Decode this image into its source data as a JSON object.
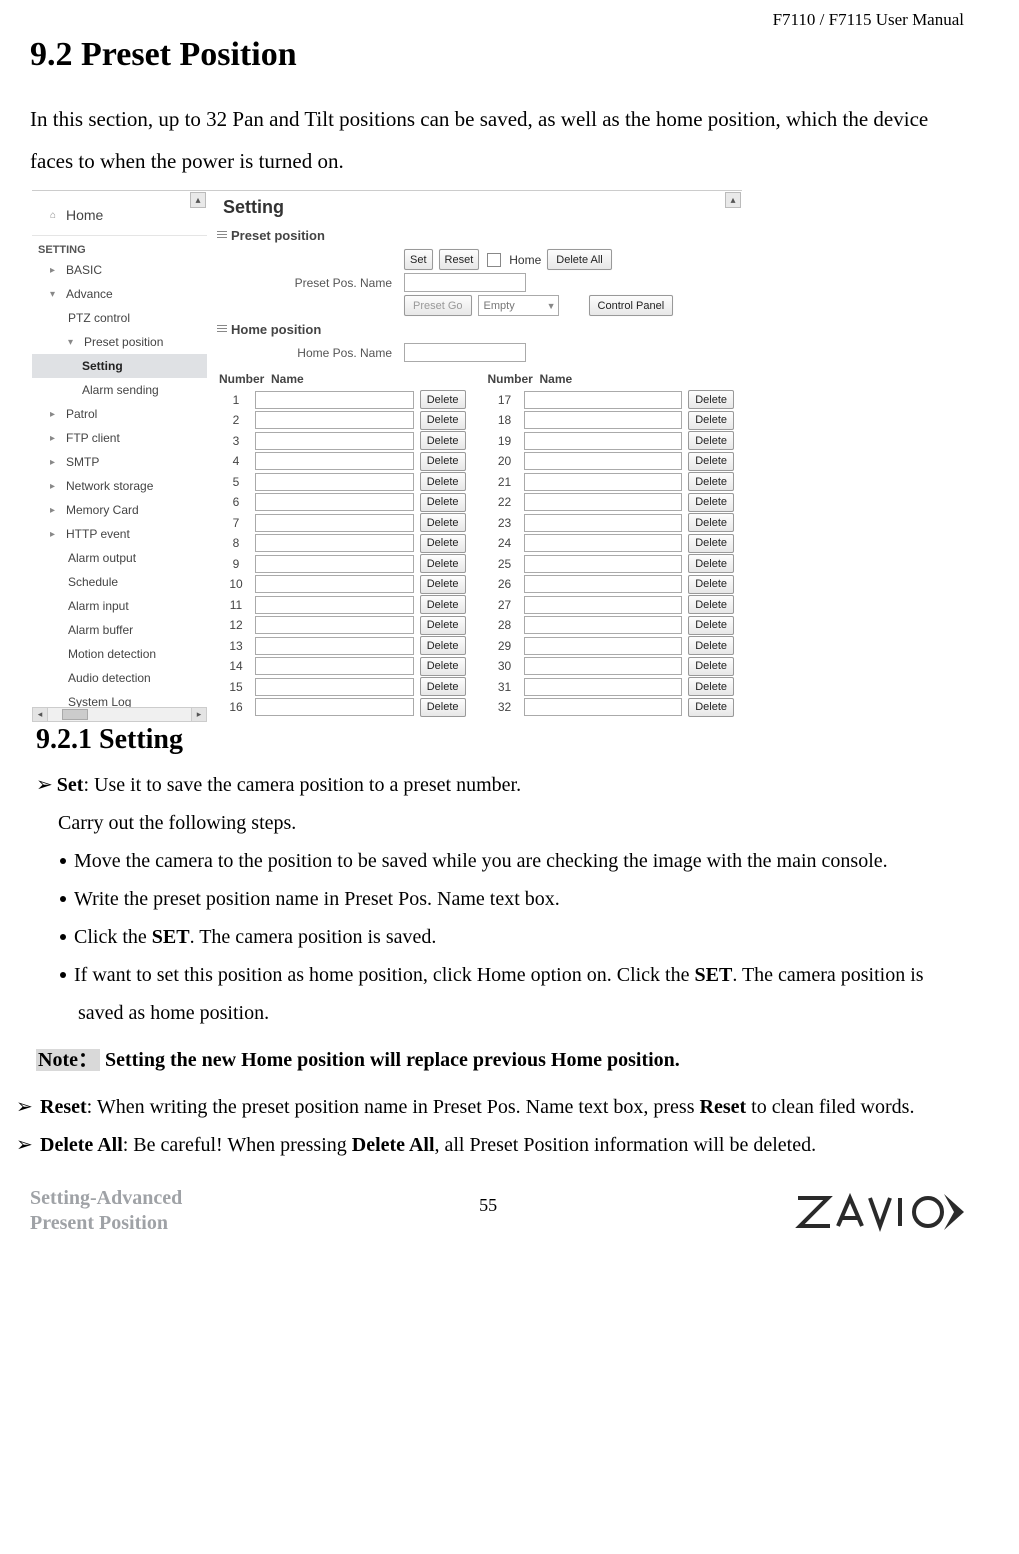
{
  "header": {
    "manual_title": "F7110 / F7115 User Manual"
  },
  "section": {
    "title": "9.2 Preset Position",
    "intro": "In this section, up to 32 Pan and Tilt positions can be saved, as well as the home position, which the device faces to when the power is turned on."
  },
  "shot": {
    "sidebar": {
      "home": "Home",
      "label_setting": "SETTING",
      "items": {
        "basic": "BASIC",
        "advance": "Advance",
        "ptz": "PTZ control",
        "preset_position": "Preset position",
        "setting": "Setting",
        "alarm_sending": "Alarm sending",
        "patrol": "Patrol",
        "ftp": "FTP client",
        "smtp": "SMTP",
        "netstore": "Network storage",
        "memcard": "Memory Card",
        "http": "HTTP event",
        "alarm_out": "Alarm output",
        "schedule": "Schedule",
        "alarm_in": "Alarm input",
        "alarm_buf": "Alarm buffer",
        "motion": "Motion detection",
        "audio": "Audio detection",
        "syslog": "System Log"
      }
    },
    "content": {
      "title": "Setting",
      "preset_heading": "Preset position",
      "set_btn": "Set",
      "reset_btn": "Reset",
      "home_check_label": "Home",
      "delete_all_btn": "Delete All",
      "preset_name_label": "Preset Pos. Name",
      "preset_go_btn": "Preset Go",
      "empty_opt": "Empty",
      "control_panel_btn": "Control Panel",
      "home_heading": "Home position",
      "home_name_label": "Home Pos. Name",
      "col_number": "Number",
      "col_name": "Name",
      "delete_btn": "Delete",
      "left_nums": [
        "1",
        "2",
        "3",
        "4",
        "5",
        "6",
        "7",
        "8",
        "9",
        "10",
        "11",
        "12",
        "13",
        "14",
        "15",
        "16"
      ],
      "right_nums": [
        "17",
        "18",
        "19",
        "20",
        "21",
        "22",
        "23",
        "24",
        "25",
        "26",
        "27",
        "28",
        "29",
        "30",
        "31",
        "32"
      ]
    }
  },
  "sub": {
    "title": "9.2.1 Setting",
    "set_label": "Set",
    "set_desc": ": Use it to save the camera position to a preset number.",
    "carry_out": "Carry out the following steps.",
    "b1": "Move the camera to the position to be saved while you are checking the image with the main console.",
    "b2": "Write the preset position name in Preset Pos. Name text box.",
    "b3_pre": "Click the ",
    "b3_set": "SET",
    "b3_post": ". The camera position is saved.",
    "b4_pre": "If want to set this position as home position, click Home option on. Click the ",
    "b4_set": "SET",
    "b4_post": ". The camera position is saved as home position.",
    "note_label": "Note：",
    "note_text": " Setting the new Home position will replace previous Home position.",
    "reset_label": "Reset",
    "reset_pre": ": When writing the preset position name in Preset Pos. Name text box, press ",
    "reset_bold": "Reset",
    "reset_post": " to clean filed words.",
    "delall_label": "Delete All",
    "delall_pre": ": Be careful! When pressing ",
    "delall_bold": "Delete All",
    "delall_post": ", all Preset Position information will be deleted."
  },
  "footer": {
    "left1": "Setting-Advanced",
    "left2": "Present Position",
    "page": "55",
    "brand": "ZAVIO"
  }
}
